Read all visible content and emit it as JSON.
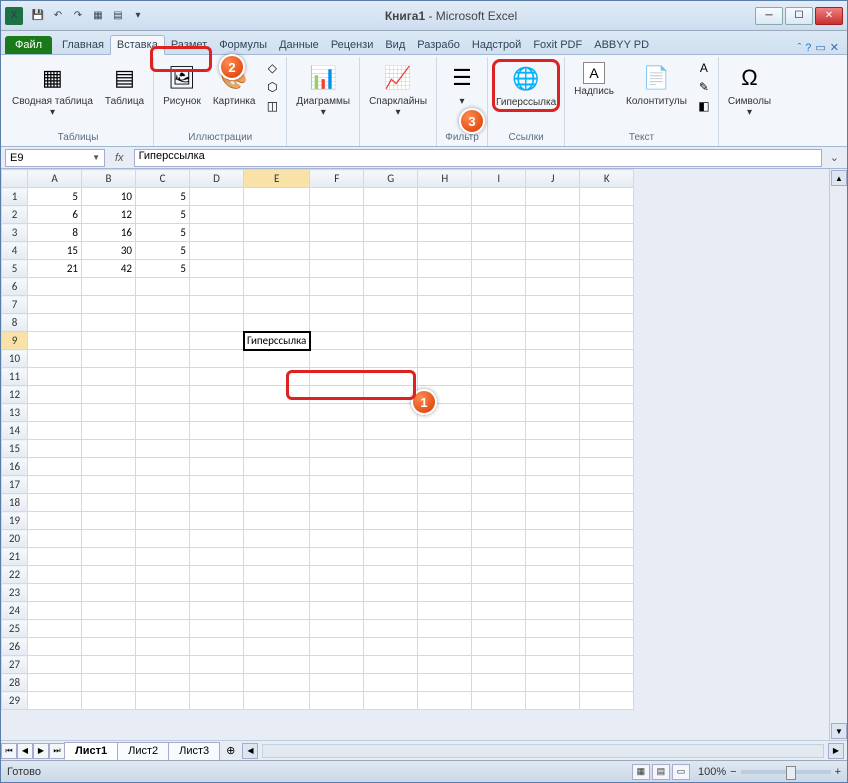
{
  "title": {
    "book": "Книга1",
    "app": "Microsoft Excel"
  },
  "ribbon": {
    "file": "Файл",
    "tabs": [
      "Главная",
      "Вставка",
      "Размет",
      "Формулы",
      "Данные",
      "Рецензи",
      "Вид",
      "Разрабо",
      "Надстрой",
      "Foxit PDF",
      "ABBYY PD"
    ],
    "active_index": 1,
    "groups": {
      "tables": {
        "label": "Таблицы",
        "pivot": "Сводная таблица",
        "table": "Таблица"
      },
      "illustrations": {
        "label": "Иллюстрации",
        "picture": "Рисунок",
        "clipart": "Картинка"
      },
      "charts": {
        "label": "",
        "item": "Диаграммы"
      },
      "sparklines": {
        "label": "",
        "item": "Спарклайны"
      },
      "filter": {
        "label": "Фильтр"
      },
      "links": {
        "label": "Ссылки",
        "hyperlink": "Гиперссылка"
      },
      "text": {
        "label": "Текст",
        "textbox": "Надпись",
        "headerfooter": "Колонтитулы"
      },
      "symbols": {
        "label": "",
        "item": "Символы"
      }
    }
  },
  "namebox": "E9",
  "formula": "Гиперссылка",
  "columns": [
    "A",
    "B",
    "C",
    "D",
    "E",
    "F",
    "G",
    "H",
    "I",
    "J",
    "K"
  ],
  "rows_visible": 29,
  "data": {
    "1": {
      "A": 5,
      "B": 10,
      "C": 5
    },
    "2": {
      "A": 6,
      "B": 12,
      "C": 5
    },
    "3": {
      "A": 8,
      "B": 16,
      "C": 5
    },
    "4": {
      "A": 15,
      "B": 30,
      "C": 5
    },
    "5": {
      "A": 21,
      "B": 42,
      "C": 5
    }
  },
  "active_cell": {
    "row": 9,
    "col": "E",
    "value": "Гиперссылка"
  },
  "sheets": [
    "Лист1",
    "Лист2",
    "Лист3"
  ],
  "active_sheet": 0,
  "status": {
    "ready": "Готово",
    "zoom": "100%"
  },
  "callouts": {
    "1": "1",
    "2": "2",
    "3": "3"
  }
}
